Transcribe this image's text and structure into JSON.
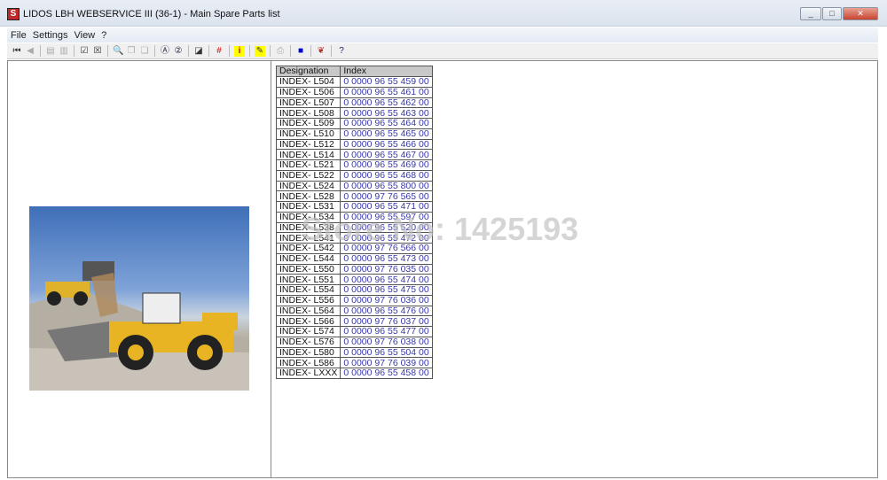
{
  "window": {
    "title": "LIDOS LBH WEBSERVICE III (36-1) - Main Spare Parts list",
    "app_icon": "lidos-logo-icon"
  },
  "menu": [
    "File",
    "Settings",
    "View",
    "?"
  ],
  "table": {
    "headers": [
      "Designation",
      "Index"
    ],
    "rows": [
      [
        "INDEX- L504",
        "0 0000  96 55 459 00"
      ],
      [
        "INDEX- L506",
        "0 0000  96 55 461 00"
      ],
      [
        "INDEX- L507",
        "0 0000  96 55 462 00"
      ],
      [
        "INDEX- L508",
        "0 0000  96 55 463 00"
      ],
      [
        "INDEX- L509",
        "0 0000  96 55 464 00"
      ],
      [
        "INDEX- L510",
        "0 0000  96 55 465 00"
      ],
      [
        "INDEX- L512",
        "0 0000  96 55 466 00"
      ],
      [
        "INDEX- L514",
        "0 0000  96 55 467 00"
      ],
      [
        "INDEX- L521",
        "0 0000  96 55 469 00"
      ],
      [
        "INDEX- L522",
        "0 0000  96 55 468 00"
      ],
      [
        "INDEX- L524",
        "0 0000  96 55 800 00"
      ],
      [
        "INDEX- L528",
        "0 0000  97 76 565 00"
      ],
      [
        "INDEX- L531",
        "0 0000  96 55 471 00"
      ],
      [
        "INDEX- L534",
        "0 0000  96 55 597 00"
      ],
      [
        "INDEX- L538",
        "0 0000  96 55 520 00"
      ],
      [
        "INDEX- L541",
        "0 0000  96 55 472 00"
      ],
      [
        "INDEX- L542",
        "0 0000  97 76 566 00"
      ],
      [
        "INDEX- L544",
        "0 0000  96 55 473 00"
      ],
      [
        "INDEX- L550",
        "0 0000  97 76 035 00"
      ],
      [
        "INDEX- L551",
        "0 0000  96 55 474 00"
      ],
      [
        "INDEX- L554",
        "0 0000  96 55 475 00"
      ],
      [
        "INDEX- L556",
        "0 0000  97 76 036 00"
      ],
      [
        "INDEX- L564",
        "0 0000  96 55 476 00"
      ],
      [
        "INDEX- L566",
        "0 0000  97 76 037 00"
      ],
      [
        "INDEX- L574",
        "0 0000  96 55 477 00"
      ],
      [
        "INDEX- L576",
        "0 0000  97 76 038 00"
      ],
      [
        "INDEX- L580",
        "0 0000  96 55 504 00"
      ],
      [
        "INDEX- L586",
        "0 0000  97 76 039 00"
      ],
      [
        "INDEX- LXXX",
        "0 0000  96 55 458 00"
      ]
    ]
  },
  "watermark": "Store No: 1425193",
  "colors": {
    "index_text": "#3838a8",
    "header_bg": "#c8c8c8"
  }
}
